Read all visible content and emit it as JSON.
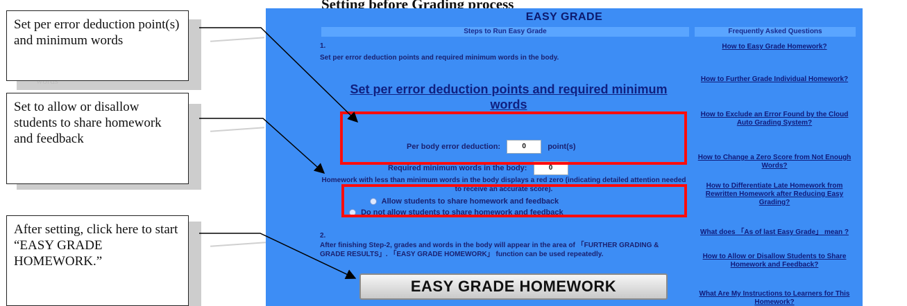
{
  "document": {
    "title": "Setting before Grading process"
  },
  "callouts": [
    {
      "text": "Set per error deduction point(s) and minimum words"
    },
    {
      "text": "Set to allow or disallow students to share homework and feedback"
    },
    {
      "text": "After setting, click here to start “EASY GRADE HOMEWORK.”"
    }
  ],
  "ghost": {
    "words_fragment": "words"
  },
  "app": {
    "title": "EASY GRADE",
    "steps_header": "Steps to Run Easy Grade",
    "faq_header": "Frequently Asked Questions",
    "step1_number": "1.",
    "step1_text": "Set per error deduction points and required minimum words in the body.",
    "section_title": "Set per error deduction points and required minimum words",
    "deduction_label": "Per body error deduction:",
    "deduction_value": "0",
    "deduction_unit": "point(s)",
    "min_words_label": "Required minimum words in the body:",
    "min_words_value": "0",
    "note_text": "Homework with less than minimum words in the body displays a red zero (indicating detailed attention needed to receive an accurate score).",
    "share_options": [
      "Allow students to share homework and feedback",
      "Do not allow students to share homework and feedback"
    ],
    "step2_number": "2.",
    "step2_text": "After finishing Step-2, grades and words in the body will appear in the area of 「FURTHER GRADING & GRADE RESULTS」. 「EASY GRADE HOMEWORK」 function can be used repeatedly.",
    "button_label": "EASY GRADE HOMEWORK",
    "faq": [
      "How to Easy Grade Homework?",
      "How to Further Grade Individual Homework?",
      "How to Exclude an Error Found by the Cloud Auto Grading System?",
      "How to Change a Zero Score from Not Enough Words?",
      "How to Differentiate Late Homework from Rewritten Homework after Reducing Easy Grading?",
      "What does 「As of last Easy Grade」 mean ?",
      "How to Allow or Disallow Students to Share Homework and Feedback?",
      "What Are My Instructions to Learners for This Homework?"
    ]
  },
  "colors": {
    "app_background": "#3d8df5",
    "highlight": "#ff0d0d",
    "link": "#101a7a"
  }
}
